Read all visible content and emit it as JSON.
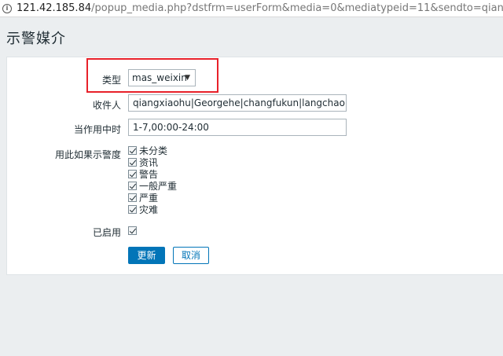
{
  "browser": {
    "url_host": "121.42.185.84",
    "url_rest": "/popup_media.php?dstfrm=userForm&media=0&mediatypeid=11&sendto=qiangxiaohu|Georgehe|changfukun"
  },
  "page": {
    "title": "示警媒介"
  },
  "form": {
    "type": {
      "label": "类型",
      "value": "mas_weixin"
    },
    "recipient": {
      "label": "收件人",
      "value": "qiangxiaohu|Georgehe|changfukun|langchao|wanghongjie"
    },
    "active_when": {
      "label": "当作用中时",
      "value": "1-7,00:00-24:00"
    },
    "severity": {
      "label": "用此如果示警度",
      "items": [
        {
          "label": "未分类",
          "checked": true
        },
        {
          "label": "资讯",
          "checked": true
        },
        {
          "label": "警告",
          "checked": true
        },
        {
          "label": "一般严重",
          "checked": true
        },
        {
          "label": "严重",
          "checked": true
        },
        {
          "label": "灾难",
          "checked": true
        }
      ]
    },
    "enabled": {
      "label": "已启用",
      "checked": true
    },
    "buttons": {
      "update": "更新",
      "cancel": "取消"
    }
  },
  "colors": {
    "highlight": "#e8212a",
    "primary": "#0275b8"
  }
}
